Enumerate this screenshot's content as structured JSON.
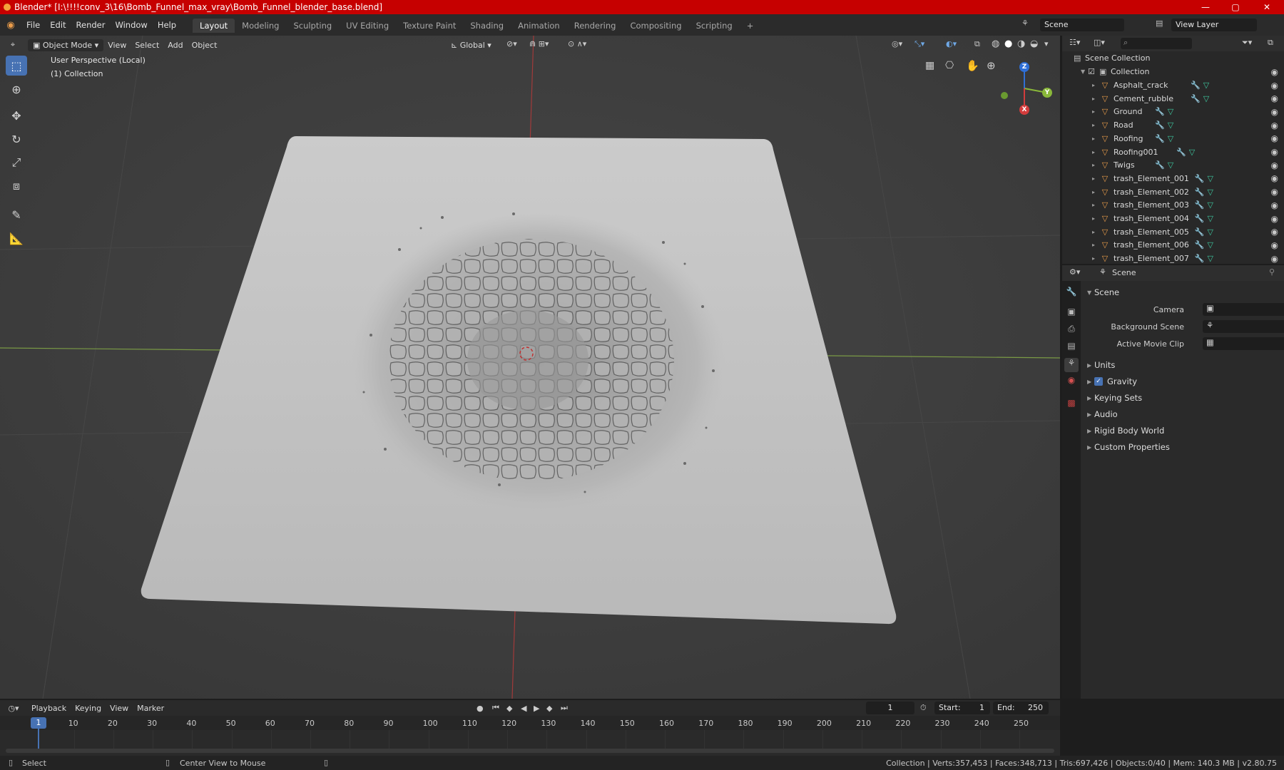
{
  "titlebar": {
    "title": "Blender* [I:\\!!!!conv_3\\16\\Bomb_Funnel_max_vray\\Bomb_Funnel_blender_base.blend]",
    "minimize": "—",
    "maximize": "▢",
    "close": "✕"
  },
  "menubar": {
    "items": [
      "File",
      "Edit",
      "Render",
      "Window",
      "Help"
    ]
  },
  "workspaces": [
    "Layout",
    "Modeling",
    "Sculpting",
    "UV Editing",
    "Texture Paint",
    "Shading",
    "Animation",
    "Rendering",
    "Compositing",
    "Scripting"
  ],
  "add_workspace": "+",
  "scene_field": "Scene",
  "viewlayer_field": "View Layer",
  "viewport": {
    "mode": "Object Mode",
    "menus": [
      "View",
      "Select",
      "Add",
      "Object"
    ],
    "transform": "Global",
    "perspective": "User Perspective (Local)",
    "collection": "(1) Collection"
  },
  "gizmo": {
    "z": "Z",
    "y": "Y",
    "x": "X"
  },
  "outliner": {
    "root": "Scene Collection",
    "collection": "Collection",
    "objects": [
      "Asphalt_crack",
      "Cement_rubble",
      "Ground",
      "Road",
      "Roofing",
      "Roofing001",
      "Twigs",
      "trash_Element_001",
      "trash_Element_002",
      "trash_Element_003",
      "trash_Element_004",
      "trash_Element_005",
      "trash_Element_006",
      "trash_Element_007"
    ]
  },
  "properties": {
    "header": "Scene",
    "section": "Scene",
    "camera_label": "Camera",
    "bg_scene_label": "Background Scene",
    "movie_clip_label": "Active Movie Clip",
    "panels": [
      "Units",
      "Gravity",
      "Keying Sets",
      "Audio",
      "Rigid Body World",
      "Custom Properties"
    ]
  },
  "timeline": {
    "menus": [
      "Playback",
      "Keying",
      "View",
      "Marker"
    ],
    "current_frame": "1",
    "start_label": "Start:",
    "start": "1",
    "end_label": "End:",
    "end": "250",
    "ticks": [
      "10",
      "20",
      "30",
      "40",
      "50",
      "60",
      "70",
      "80",
      "90",
      "100",
      "110",
      "120",
      "130",
      "140",
      "150",
      "160",
      "170",
      "180",
      "190",
      "200",
      "210",
      "220",
      "230",
      "240",
      "250"
    ],
    "cursor_frame": "1"
  },
  "statusbar": {
    "select": "Select",
    "center": "Center View to Mouse",
    "stats": "Collection | Verts:357,453 | Faces:348,713 | Tris:697,426 | Objects:0/40 | Mem: 140.3 MB | v2.80.75"
  }
}
